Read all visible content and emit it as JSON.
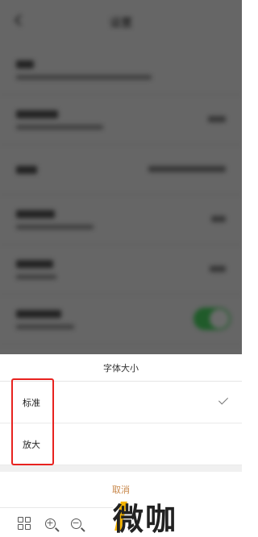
{
  "background": {
    "title": "设置",
    "dim_color": "#000000"
  },
  "sheet": {
    "title": "字体大小",
    "options": [
      {
        "label": "标准",
        "selected": true
      },
      {
        "label": "放大",
        "selected": false
      }
    ],
    "cancel_label": "取消",
    "accent_color": "#c8874a"
  },
  "highlight": {
    "color": "#e8221f"
  },
  "toolbar": {
    "icons": [
      "grid-icon",
      "zoom-in-icon",
      "zoom-out-icon"
    ],
    "zoom_in_symbol": "+",
    "zoom_out_symbol": "−"
  },
  "watermark": {
    "text": "微咖",
    "mark_color": "#f5b400"
  }
}
